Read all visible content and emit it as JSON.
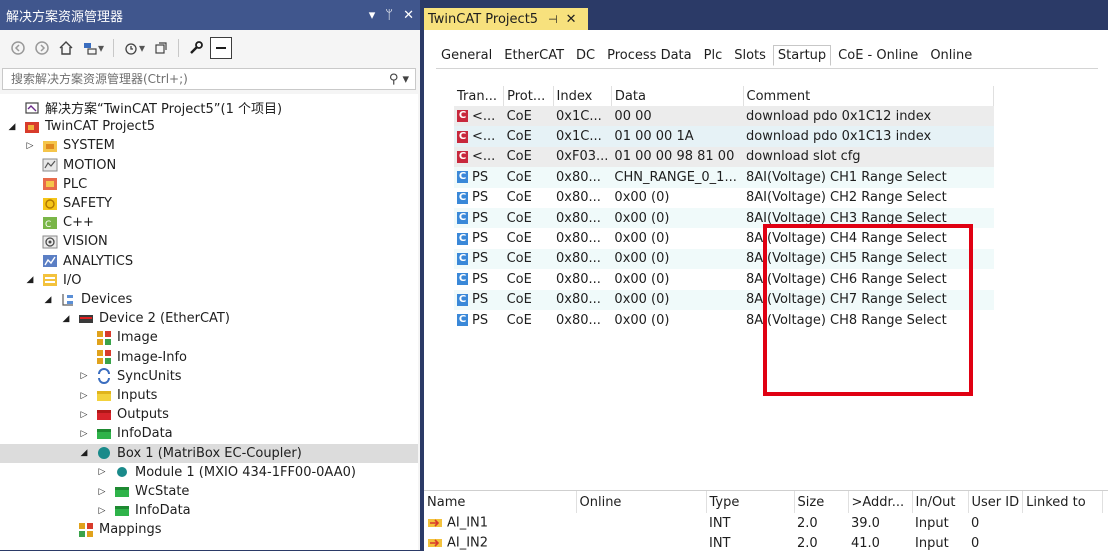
{
  "colors": {
    "title_bar": "#40568d",
    "doc_tab": "#f7e17d",
    "highlight": "#e00012",
    "selected_row": "#dcdcdc",
    "c_icon": "#c8283c",
    "ps_icon": "#3a88d8"
  },
  "solution_explorer": {
    "title": "解决方案资源管理器",
    "header_buttons": [
      "▾",
      "ᛘ",
      "✕"
    ],
    "search_placeholder": "搜索解决方案资源管理器(Ctrl+;)",
    "tree": [
      {
        "level": 0,
        "expander": "",
        "icon": "solution-icon",
        "label": "解决方案“TwinCAT Project5”(1 个项目)"
      },
      {
        "level": 0,
        "expander": "◢",
        "icon": "project-icon",
        "label": "TwinCAT Project5"
      },
      {
        "level": 1,
        "expander": "▷",
        "icon": "system-icon",
        "label": "SYSTEM"
      },
      {
        "level": 1,
        "expander": "",
        "icon": "motion-icon",
        "label": "MOTION"
      },
      {
        "level": 1,
        "expander": "",
        "icon": "plc-icon",
        "label": "PLC"
      },
      {
        "level": 1,
        "expander": "",
        "icon": "safety-icon",
        "label": "SAFETY"
      },
      {
        "level": 1,
        "expander": "",
        "icon": "cpp-icon",
        "label": "C++"
      },
      {
        "level": 1,
        "expander": "",
        "icon": "vision-icon",
        "label": "VISION"
      },
      {
        "level": 1,
        "expander": "",
        "icon": "analytics-icon",
        "label": "ANALYTICS"
      },
      {
        "level": 1,
        "expander": "◢",
        "icon": "io-icon",
        "label": "I/O"
      },
      {
        "level": 2,
        "expander": "◢",
        "icon": "devices-icon",
        "label": "Devices"
      },
      {
        "level": 3,
        "expander": "◢",
        "icon": "ethercat-device-icon",
        "label": "Device 2 (EtherCAT)"
      },
      {
        "level": 4,
        "expander": "",
        "icon": "image-icon",
        "label": "Image"
      },
      {
        "level": 4,
        "expander": "",
        "icon": "image-info-icon",
        "label": "Image-Info"
      },
      {
        "level": 4,
        "expander": "▷",
        "icon": "syncunits-icon",
        "label": "SyncUnits"
      },
      {
        "level": 4,
        "expander": "▷",
        "icon": "inputs-icon",
        "label": "Inputs"
      },
      {
        "level": 4,
        "expander": "▷",
        "icon": "outputs-icon",
        "label": "Outputs"
      },
      {
        "level": 4,
        "expander": "▷",
        "icon": "infodata-icon",
        "label": "InfoData"
      },
      {
        "level": 4,
        "expander": "◢",
        "icon": "box-icon",
        "label": "Box 1 (MatriBox EC-Coupler)",
        "selected": true
      },
      {
        "level": 5,
        "expander": "▷",
        "icon": "module-icon",
        "label": "Module 1 (MXIO 434-1FF00-0AA0)"
      },
      {
        "level": 5,
        "expander": "▷",
        "icon": "wcstate-icon",
        "label": "WcState"
      },
      {
        "level": 5,
        "expander": "▷",
        "icon": "infodata-icon",
        "label": "InfoData"
      },
      {
        "level": 3,
        "expander": "",
        "icon": "mappings-icon",
        "label": "Mappings"
      }
    ]
  },
  "editor": {
    "doc_tab": {
      "title": "TwinCAT Project5",
      "pin": "⊣",
      "close": "✕"
    },
    "tabs": [
      "General",
      "EtherCAT",
      "DC",
      "Process Data",
      "Plc",
      "Slots",
      "Startup",
      "CoE - Online",
      "Online"
    ],
    "active_tab": "Startup",
    "startup": {
      "columns": [
        "Tran...",
        "Prot...",
        "Index",
        "Data",
        "Comment"
      ],
      "rows": [
        {
          "type": "C",
          "tran": "<...",
          "prot": "CoE",
          "index": "0x1C...",
          "data": "00 00",
          "comment": "download pdo 0x1C12 index"
        },
        {
          "type": "C",
          "tran": "<...",
          "prot": "CoE",
          "index": "0x1C...",
          "data": "01 00 00 1A",
          "comment": "download pdo 0x1C13 index"
        },
        {
          "type": "C",
          "tran": "<...",
          "prot": "CoE",
          "index": "0xF03...",
          "data": "01 00 00 98 81 00",
          "comment": "download slot cfg"
        },
        {
          "type": "C",
          "tran": "PS",
          "prot": "CoE",
          "index": "0x80...",
          "data": "CHN_RANGE_0_1...",
          "comment": "8AI(Voltage) CH1 Range Select"
        },
        {
          "type": "C",
          "tran": "PS",
          "prot": "CoE",
          "index": "0x80...",
          "data": "0x00 (0)",
          "comment": "8AI(Voltage) CH2 Range Select"
        },
        {
          "type": "C",
          "tran": "PS",
          "prot": "CoE",
          "index": "0x80...",
          "data": "0x00 (0)",
          "comment": "8AI(Voltage) CH3 Range Select"
        },
        {
          "type": "C",
          "tran": "PS",
          "prot": "CoE",
          "index": "0x80...",
          "data": "0x00 (0)",
          "comment": "8AI(Voltage) CH4 Range Select"
        },
        {
          "type": "C",
          "tran": "PS",
          "prot": "CoE",
          "index": "0x80...",
          "data": "0x00 (0)",
          "comment": "8AI(Voltage) CH5 Range Select"
        },
        {
          "type": "C",
          "tran": "PS",
          "prot": "CoE",
          "index": "0x80...",
          "data": "0x00 (0)",
          "comment": "8AI(Voltage) CH6 Range Select"
        },
        {
          "type": "C",
          "tran": "PS",
          "prot": "CoE",
          "index": "0x80...",
          "data": "0x00 (0)",
          "comment": "8AI(Voltage) CH7 Range Select"
        },
        {
          "type": "C",
          "tran": "PS",
          "prot": "CoE",
          "index": "0x80...",
          "data": "0x00 (0)",
          "comment": "8AI(Voltage) CH8 Range Select"
        }
      ]
    },
    "variables": {
      "columns": [
        "Name",
        "Online",
        "Type",
        "Size",
        ">Addr...",
        "In/Out",
        "User ID",
        "Linked to"
      ],
      "rows": [
        {
          "name": "AI_IN1",
          "online": "",
          "type": "INT",
          "size": "2.0",
          "addr": "39.0",
          "inout": "Input",
          "userid": "0",
          "linked": ""
        },
        {
          "name": "AI_IN2",
          "online": "",
          "type": "INT",
          "size": "2.0",
          "addr": "41.0",
          "inout": "Input",
          "userid": "0",
          "linked": ""
        }
      ]
    }
  }
}
